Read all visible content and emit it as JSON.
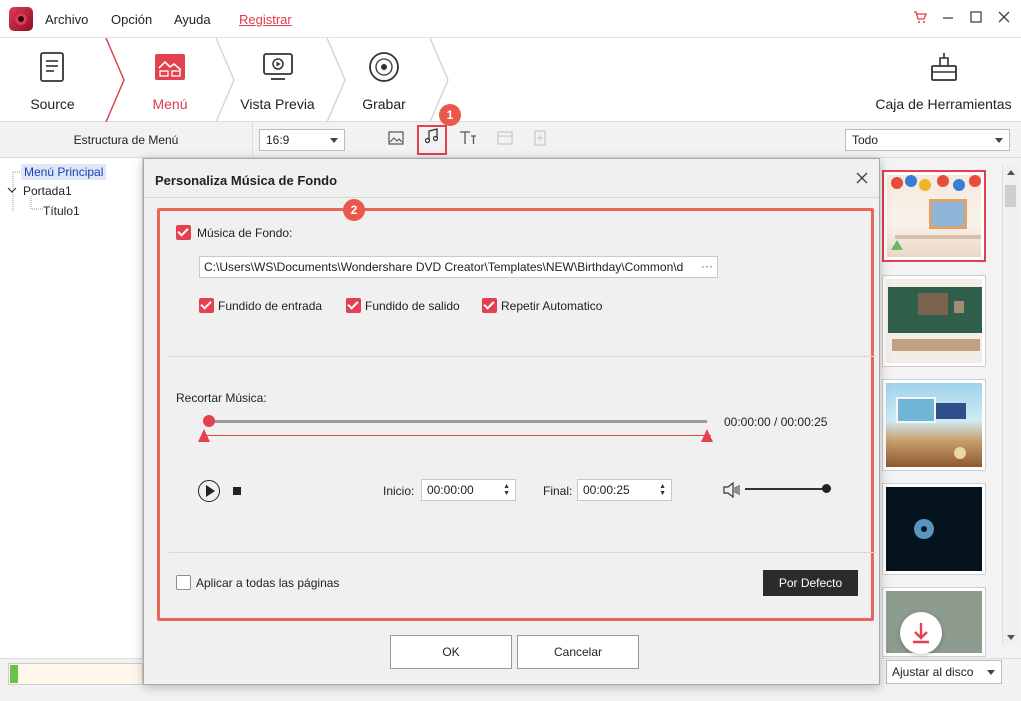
{
  "menu": {
    "archivo": "Archivo",
    "opcion": "Opción",
    "ayuda": "Ayuda",
    "registrar": "Registrar"
  },
  "steps": [
    {
      "label": "Source",
      "icon": "document-icon"
    },
    {
      "label": "Menú",
      "icon": "menu-template-icon"
    },
    {
      "label": "Vista Previa",
      "icon": "preview-monitor-icon"
    },
    {
      "label": "Grabar",
      "icon": "burn-disc-icon"
    }
  ],
  "toolbox": {
    "label": "Caja de Herramientas",
    "icon": "toolbox-icon"
  },
  "subbar": {
    "structure_label": "Estructura de Menú",
    "aspect_ratio": "16:9",
    "filter": "Todo"
  },
  "tree": {
    "root": "Menú Principal",
    "child": "Portada1",
    "grandchild": "Título1"
  },
  "dialog": {
    "title": "Personaliza Música de Fondo",
    "bg_music_label": "Música de Fondo:",
    "bg_music_checked": true,
    "path": "C:\\Users\\WS\\Documents\\Wondershare DVD Creator\\Templates\\NEW\\Birthday\\Common\\d",
    "path_more": "···",
    "fade_in": "Fundido de entrada",
    "fade_out": "Fundido de salido",
    "repeat": "Repetir Automatico",
    "trim_label": "Recortar Música:",
    "time_display": "00:00:00 / 00:00:25",
    "start_label": "Inicio:",
    "start_value": "00:00:00",
    "end_label": "Final:",
    "end_value": "00:00:25",
    "apply_all": "Aplicar a todas las páginas",
    "default_button": "Por Defecto",
    "ok_button": "OK",
    "cancel_button": "Cancelar",
    "badge1": "1",
    "badge2": "2"
  },
  "bottom": {
    "fit_select": "Ajustar al disco"
  },
  "colors": {
    "accent": "#e3414f",
    "annotation": "#e8675c",
    "dark_button": "#2b2b2b"
  }
}
